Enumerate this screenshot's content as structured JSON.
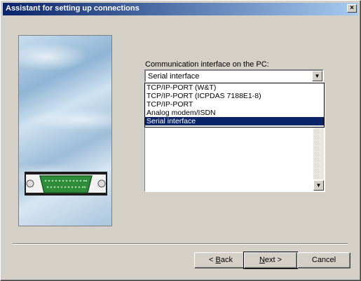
{
  "window": {
    "title": "Assistant for setting up connections",
    "close_glyph": "×"
  },
  "image": {
    "icon": "serial-connector-icon"
  },
  "interface": {
    "label": "Communication interface on the PC:",
    "selected": "Serial interface",
    "options": [
      "TCP/IP-PORT (W&T)",
      "TCP/IP-PORT (ICPDAS 7188E1-8)",
      "TCP/IP-PORT",
      "Analog modem/ISDN",
      "Serial interface"
    ],
    "selected_index": 4
  },
  "buttons": {
    "back_prefix": "< ",
    "back_key": "B",
    "back_rest": "ack",
    "next_key": "N",
    "next_rest": "ext >",
    "cancel": "Cancel"
  },
  "colors": {
    "title_start": "#0a246a",
    "title_end": "#a6caf0",
    "selection": "#0a246a",
    "connector": "#2e8b3a"
  }
}
